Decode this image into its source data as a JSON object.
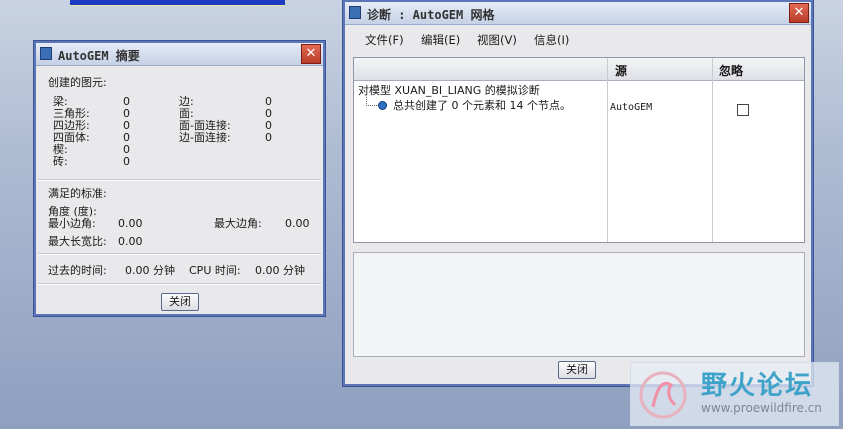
{
  "summary_window": {
    "title": "AutoGEM 摘要",
    "close_glyph": "✕",
    "created_header": "创建的图元:",
    "elements_left": [
      {
        "label": "梁:",
        "value": "0"
      },
      {
        "label": "三角形:",
        "value": "0"
      },
      {
        "label": "四边形:",
        "value": "0"
      },
      {
        "label": "四面体:",
        "value": "0"
      },
      {
        "label": "楔:",
        "value": "0"
      },
      {
        "label": "砖:",
        "value": "0"
      }
    ],
    "elements_right": [
      {
        "label": "边:",
        "value": "0"
      },
      {
        "label": "面:",
        "value": "0"
      },
      {
        "label": "面-面连接:",
        "value": "0"
      },
      {
        "label": "边-面连接:",
        "value": "0"
      }
    ],
    "criteria_header": "满足的标准:",
    "angle_label": "角度 (度):",
    "min_edge_angle_label": "最小边角:",
    "min_edge_angle_value": "0.00",
    "max_edge_angle_label": "最大边角:",
    "max_edge_angle_value": "0.00",
    "max_aspect_label": "最大长宽比:",
    "max_aspect_value": "0.00",
    "elapsed_label": "过去的时间:",
    "elapsed_value": "0.00 分钟",
    "cpu_label": "CPU 时间:",
    "cpu_value": "0.00 分钟",
    "close_button": "关闭"
  },
  "diag_window": {
    "title": "诊断 : AutoGEM 网格",
    "close_glyph": "✕",
    "menu": [
      "文件(F)",
      "编辑(E)",
      "视图(V)",
      "信息(I)"
    ],
    "columns": [
      "",
      "源",
      "忽略"
    ],
    "root_row": "对模型 XUAN_BI_LIANG 的模拟诊断",
    "child_row": "总共创建了 0 个元素和 14 个节点。",
    "child_source": "AutoGEM",
    "ignore_checked": false,
    "close_button": "关闭"
  },
  "watermark": {
    "title": "野火论坛",
    "url": "www.proewildfire.cn"
  },
  "colors": {
    "title_accent": "#3b6fb5",
    "close_red": "#c0442e",
    "info_dot": "#2f6fc4"
  }
}
